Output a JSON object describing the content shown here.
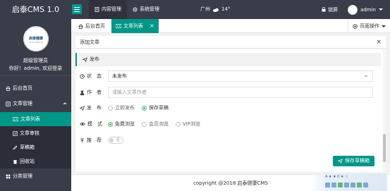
{
  "app": {
    "title": "启泰CMS 1.0"
  },
  "top_nav": [
    {
      "label": "内容管理",
      "active": true,
      "icon": "document-icon"
    },
    {
      "label": "系统管理",
      "active": false,
      "icon": "gear-icon"
    }
  ],
  "weather": {
    "city": "广州",
    "icon": "cloud-icon",
    "temp": "14°"
  },
  "header_right": {
    "lock_label": "锁屏",
    "user_name": "admin"
  },
  "sidebar": {
    "logo_text": "启泰健康",
    "logo_sub": "QTAI HEALTH",
    "role": "超级管理员",
    "greeting": "你好！admin, 欢迎登录",
    "items": [
      {
        "label": "后台首页",
        "icon": "home-icon"
      },
      {
        "label": "文章管理",
        "icon": "article-icon",
        "expanded": true
      },
      {
        "label": "文章列表",
        "icon": "list-icon",
        "sub": true,
        "active": true
      },
      {
        "label": "文章审核",
        "icon": "audit-icon",
        "sub": true
      },
      {
        "label": "草稿箱",
        "icon": "draft-icon",
        "sub": true
      },
      {
        "label": "回收站",
        "icon": "trash-icon",
        "sub": true
      },
      {
        "label": "分类管理",
        "icon": "category-icon"
      }
    ]
  },
  "tabs": [
    {
      "label": "后台首页",
      "active": false,
      "icon": "home-icon"
    },
    {
      "label": "文章列表",
      "active": true,
      "icon": "list-icon",
      "close": "×"
    }
  ],
  "page_ops_label": "页面操作",
  "panel": {
    "title": "添加文章",
    "close": "×"
  },
  "section_title": "发布",
  "form": {
    "status": {
      "label": "状　态",
      "value": "未发布"
    },
    "author": {
      "label": "作　者",
      "placeholder": "请输入文章作者"
    },
    "publish": {
      "label": "发　布",
      "options": [
        "立即发布",
        "保存草稿"
      ],
      "selected": "保存草稿"
    },
    "mode": {
      "label": "模　式",
      "options": [
        "免费浏览",
        "会员浏览",
        "VIP浏览"
      ],
      "selected": "免费浏览"
    },
    "recommend": {
      "label": "推　荐",
      "switch_text": "否"
    },
    "save_label": "保存草稿箱"
  },
  "footer": {
    "copyright": "copyright @2018 启泰健康CMS"
  },
  "tray": {
    "text": "A ♦ ♦ 0 ♦ ☆"
  },
  "colors": {
    "accent": "#009688",
    "dark": "#393d49",
    "radio": "#5fb878"
  }
}
